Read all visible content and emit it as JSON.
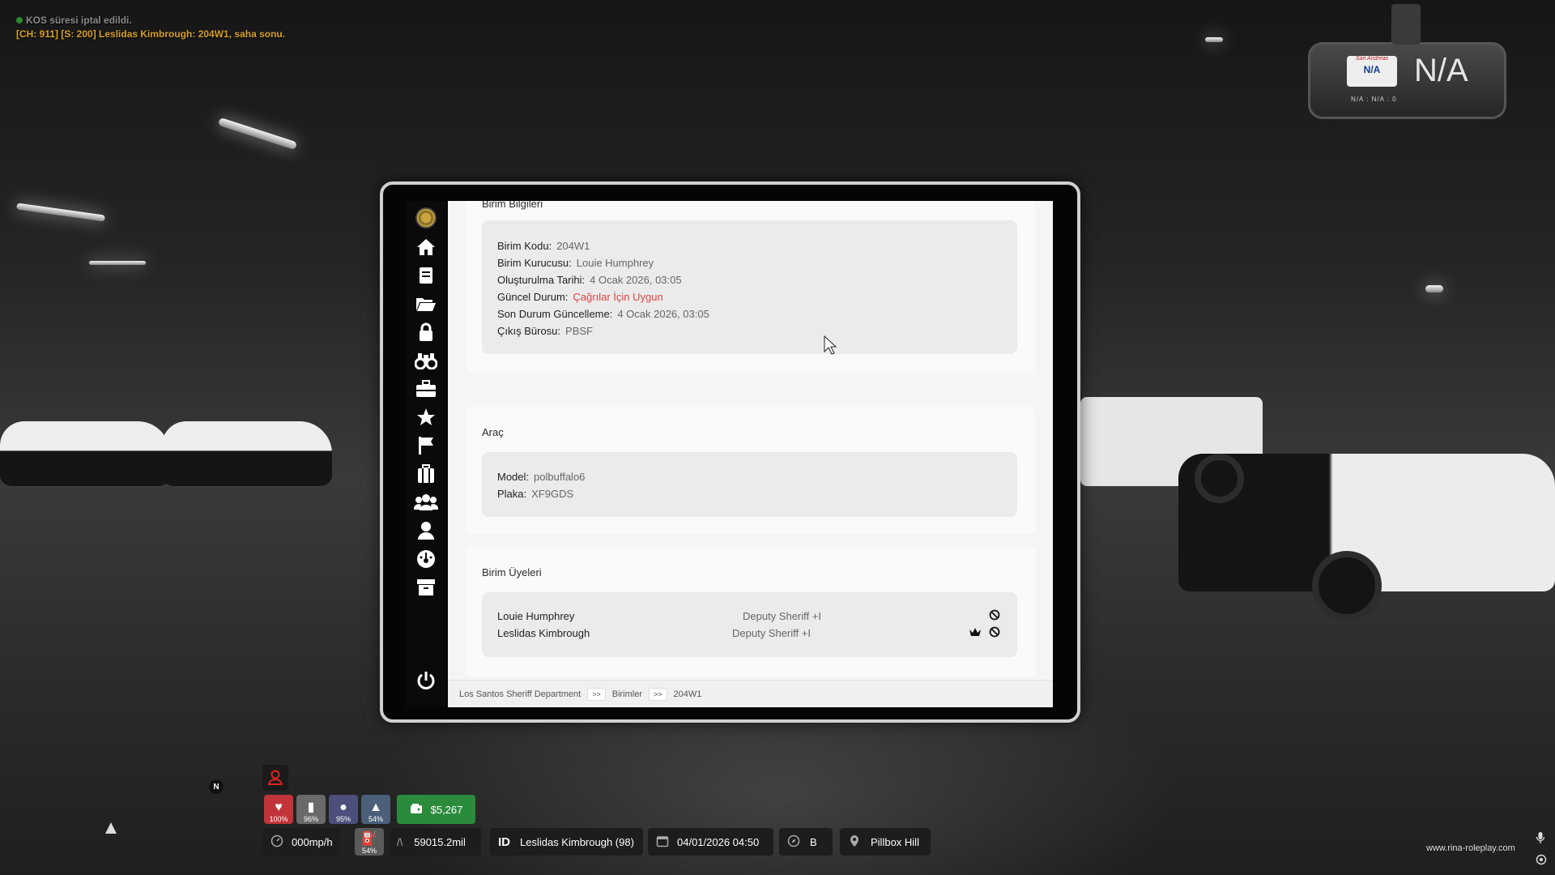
{
  "chat": {
    "line1": "KOS süresi iptal edildi.",
    "line2": "[CH: 911] [S: 200] Leslidas Kimbrough: 204W1, saha sonu."
  },
  "dashcam": {
    "plate_top": "San Andreas",
    "plate_text": "N/A",
    "big_text": "N/A",
    "small_text": "N/A : N/A : 0"
  },
  "sidebar": {
    "items": [
      {
        "icon": "home-icon"
      },
      {
        "icon": "notes-icon"
      },
      {
        "icon": "folder-icon"
      },
      {
        "icon": "lock-icon"
      },
      {
        "icon": "binoculars-icon"
      },
      {
        "icon": "briefcase-icon"
      },
      {
        "icon": "star-icon"
      },
      {
        "icon": "flag-icon"
      },
      {
        "icon": "suitcase-icon"
      },
      {
        "icon": "group-icon"
      },
      {
        "icon": "user-icon"
      },
      {
        "icon": "dashboard-icon"
      },
      {
        "icon": "archive-icon"
      }
    ],
    "power_icon": "power-icon"
  },
  "unit_info": {
    "title": "Birim Bilgileri",
    "fields": [
      {
        "label": "Birim Kodu:",
        "value": "204W1"
      },
      {
        "label": "Birim Kurucusu:",
        "value": "Louie Humphrey"
      },
      {
        "label": "Oluşturulma Tarihi:",
        "value": "4 Ocak 2026, 03:05"
      },
      {
        "label": "Güncel Durum:",
        "value": "Çağrılar İçin Uygun"
      },
      {
        "label": "Son Durum Güncelleme:",
        "value": "4 Ocak 2026, 03:05"
      },
      {
        "label": "Çıkış Bürosu:",
        "value": "PBSF"
      }
    ],
    "status_color": "#e04545"
  },
  "vehicle": {
    "title": "Araç",
    "fields": [
      {
        "label": "Model:",
        "value": "polbuffalo6"
      },
      {
        "label": "Plaka:",
        "value": "XF9GDS"
      }
    ]
  },
  "members": {
    "title": "Birim Üyeleri",
    "rows": [
      {
        "name": "Louie Humphrey",
        "rank": "Deputy Sheriff +I",
        "leader": false
      },
      {
        "name": "Leslidas Kimbrough",
        "rank": "Deputy Sheriff +I",
        "leader": true
      }
    ]
  },
  "breadcrumb": {
    "items": [
      "Los Santos Sheriff Department",
      "Birimler",
      "204W1"
    ],
    "separator": ">>"
  },
  "hud": {
    "health": "100%",
    "armor": "96%",
    "hunger": "95%",
    "thirst": "54%",
    "money": "$5,267",
    "speed": "000mp/h",
    "fuel": "54%",
    "odometer": "59015.2mil",
    "id_label": "ID",
    "player": "Leslidas Kimbrough (98)",
    "datetime": "04/01/2026 04:50",
    "direction": "B",
    "location": "Pillbox Hill",
    "compass": "N",
    "website": "www.rina-roleplay.com"
  },
  "colors": {
    "money_bg": "#2a8b3b",
    "health_bg": "#c0343a",
    "hunger_bg": "#4b4f7a",
    "thirst_bg": "#4b5f7a",
    "armor_bg": "#6a6a6a"
  }
}
